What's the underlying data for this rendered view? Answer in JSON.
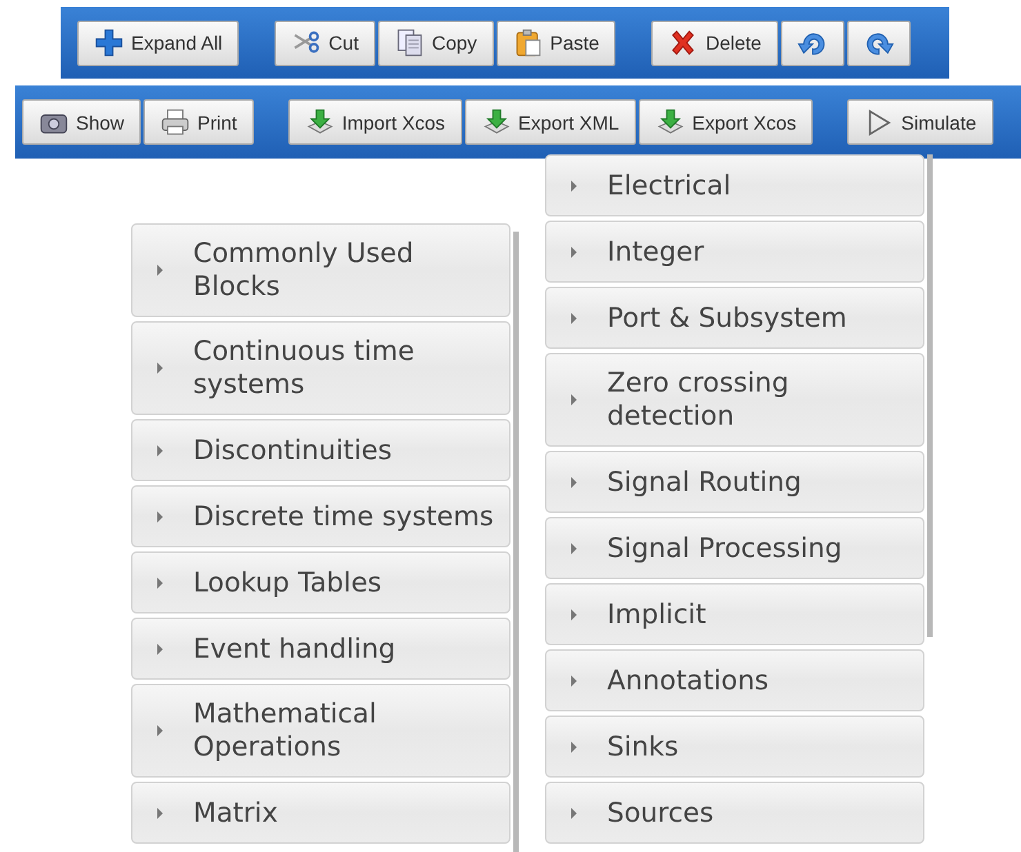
{
  "toolbars": [
    {
      "groups": [
        [
          {
            "label": "Expand All",
            "kind": "plus"
          }
        ],
        [
          {
            "label": "Cut",
            "kind": "scissors"
          },
          {
            "label": "Copy",
            "kind": "copy"
          },
          {
            "label": "Paste",
            "kind": "paste"
          }
        ],
        [
          {
            "label": "Delete",
            "kind": "delete"
          },
          {
            "kind": "undo"
          },
          {
            "kind": "redo"
          }
        ]
      ]
    },
    {
      "groups": [
        [
          {
            "label": "Show",
            "kind": "camera"
          },
          {
            "label": "Print",
            "kind": "printer"
          }
        ],
        [
          {
            "label": "Import Xcos",
            "kind": "download"
          },
          {
            "label": "Export XML",
            "kind": "download"
          },
          {
            "label": "Export Xcos",
            "kind": "download"
          }
        ],
        [
          {
            "label": "Simulate",
            "kind": "play"
          }
        ]
      ]
    }
  ],
  "palette": {
    "columns": [
      {
        "items": [
          {
            "label": "Commonly Used Blocks"
          },
          {
            "label": "Continuous time systems"
          },
          {
            "label": "Discontinuities"
          },
          {
            "label": "Discrete time systems"
          },
          {
            "label": "Lookup Tables"
          },
          {
            "label": "Event handling"
          },
          {
            "label": "Mathematical Operations"
          },
          {
            "label": "Matrix"
          }
        ]
      },
      {
        "items": [
          {
            "label": "Electrical"
          },
          {
            "label": "Integer"
          },
          {
            "label": "Port & Subsystem"
          },
          {
            "label": "Zero crossing detection"
          },
          {
            "label": "Signal Routing"
          },
          {
            "label": "Signal Processing"
          },
          {
            "label": "Implicit"
          },
          {
            "label": "Annotations"
          },
          {
            "label": "Sinks"
          },
          {
            "label": "Sources"
          }
        ]
      }
    ]
  }
}
